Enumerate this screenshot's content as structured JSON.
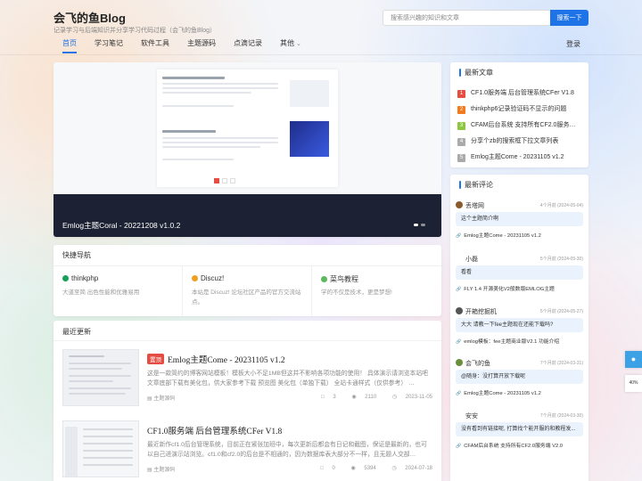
{
  "site": {
    "title": "会飞的鱼Blog",
    "subtitle": "记录学习与后端知识并分享学习代码过程（会飞的鱼Blog）"
  },
  "search": {
    "placeholder": "搜索感兴趣的知识和文章",
    "button": "搜索一下"
  },
  "nav": {
    "items": [
      "首页",
      "学习笔记",
      "软件工具",
      "主题源码",
      "点滴记录",
      "其他"
    ],
    "active_index": 0,
    "login": "登录"
  },
  "banner": {
    "caption": "Emlog主题Coral - 20221208 v1.0.2"
  },
  "quick_nav": {
    "title": "快捷导航",
    "items": [
      {
        "name": "thinkphp",
        "desc": "大道至简 出色性能和优雅易用",
        "color": "#18a058"
      },
      {
        "name": "Discuz!",
        "desc": "本站是 Discuz! 论坛社区产品的官方交流站点。",
        "color": "#f0a020"
      },
      {
        "name": "菜鸟教程",
        "desc": "学的不仅是技术，更是梦想!",
        "color": "#5cb85c"
      }
    ]
  },
  "latest": {
    "title": "最近更新",
    "posts": [
      {
        "tag": "置顶",
        "title": "Emlog主题Come - 20231105 v1.2",
        "excerpt": "这是一款简约的博客网站模板！模板大小不足1MB但这并不影响各项功能的使用！ 具体演示请浏览本站吧 文章底部下载有美化包，供大家参考下载 预览图 美化包（单独下载） 全站卡通样式（仅供参考） …",
        "category": "主题源码",
        "comments": "3",
        "views": "2110",
        "date": "2023-11-05"
      },
      {
        "tag": "",
        "title": "CF1.0服务端 后台管理系统CFer V1.8",
        "excerpt": "最近新作cf1.0后台管理系统，目前正在紧张加班中，每次更新后都会有日记和截图，保证是最新的，也可以自己进演示站浏览。cf1.0和cf2.0的后台是不相通的，因为数据库表大部分不一样，且无题人交部…",
        "category": "主题源码",
        "comments": "0",
        "views": "5394",
        "date": "2024-07-18"
      }
    ]
  },
  "newest": {
    "title": "最新文章",
    "items": [
      {
        "num": "1",
        "text": "CF1.0服务端 后台管理系统CFer V1.8",
        "color": "#e54d42"
      },
      {
        "num": "2",
        "text": "thinkphp6记录验证码不显示的问题",
        "color": "#f37b1d"
      },
      {
        "num": "3",
        "text": "CFAM后台系统 支持所有CF2.0服务…",
        "color": "#8dc63f"
      },
      {
        "num": "4",
        "text": "分享个zb的搜索框下拉文章列表",
        "color": "#aaaaaa"
      },
      {
        "num": "5",
        "text": "Emlog主题Come - 20231105 v1.2",
        "color": "#aaaaaa"
      }
    ]
  },
  "comments": {
    "title": "最新评论",
    "items": [
      {
        "user": "丢塔网",
        "time": "4个月前 (2024-05-04)",
        "content": "这个主题简介啊",
        "ref": "Emlog主题Come - 20231105 v1.2"
      },
      {
        "user": "小磊",
        "time": "5个月前 (2024-05-30)",
        "content": "看看",
        "ref": "FLY 1.4 开源美化V2般数版EMLOG主题"
      },
      {
        "user": "开箱挖掘机",
        "time": "5个月前 (2024-05-27)",
        "content": "大大 请教一下fee主题现在还能下载吗?",
        "ref": "emlog模板：fee主题商业版V2.1 功能介绍"
      },
      {
        "user": "会飞的鱼",
        "time": "7个月前 (2024-03-31)",
        "content": "@随身：没打算开放下载呢",
        "ref": "Emlog主题Come - 20231105 v1.2"
      },
      {
        "user": "安安",
        "time": "7个月前 (2024-03-30)",
        "content": "没有看到有链接呢, 打算找个能开服的和教程发...",
        "ref": "CFAM后台系统 支持所有CF2.0服务端 V2.0"
      }
    ]
  },
  "float": {
    "pct": "40%"
  }
}
